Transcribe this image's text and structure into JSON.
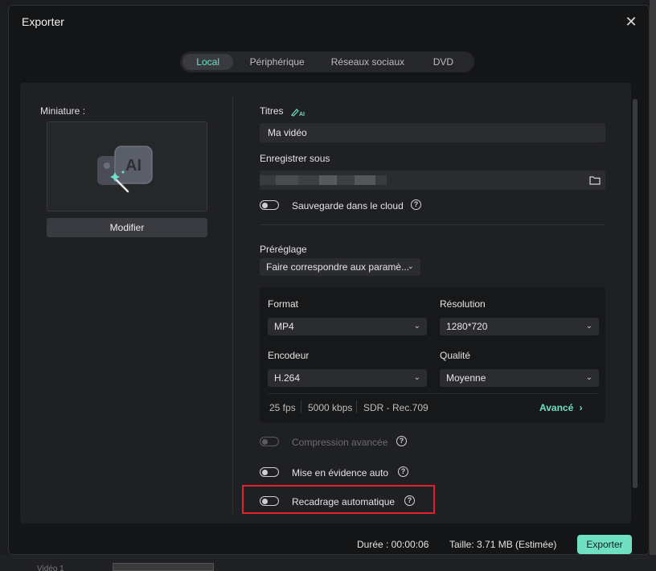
{
  "dialog": {
    "title": "Exporter",
    "close_icon": "close-icon"
  },
  "tabs": [
    {
      "label": "Local",
      "active": true
    },
    {
      "label": "Périphérique",
      "active": false
    },
    {
      "label": "Réseaux sociaux",
      "active": false
    },
    {
      "label": "DVD",
      "active": false
    }
  ],
  "thumbnail": {
    "label": "Miniature :",
    "modify_label": "Modifier",
    "icon": "ai-image-icon"
  },
  "title_field": {
    "label": "Titres",
    "value": "Ma vidéo",
    "ai_icon": "ai-pen-icon"
  },
  "save_as": {
    "label": "Enregistrer sous",
    "folder_icon": "folder-icon"
  },
  "cloud_backup": {
    "label": "Sauvegarde dans le cloud",
    "enabled": false
  },
  "preset": {
    "label": "Préréglage",
    "value": "Faire correspondre aux paramè..."
  },
  "settings": {
    "format_label": "Format",
    "format_value": "MP4",
    "resolution_label": "Résolution",
    "resolution_value": "1280*720",
    "encoder_label": "Encodeur",
    "encoder_value": "H.264",
    "quality_label": "Qualité",
    "quality_value": "Moyenne",
    "fps": "25 fps",
    "bitrate": "5000 kbps",
    "color_space": "SDR - Rec.709",
    "advanced_label": "Avancé"
  },
  "options": {
    "advanced_compression": {
      "label": "Compression avancée",
      "enabled": false,
      "disabled": true
    },
    "auto_highlight": {
      "label": "Mise en évidence auto",
      "enabled": false
    },
    "auto_reframe": {
      "label": "Recadrage automatique",
      "enabled": false
    }
  },
  "footer": {
    "duration": "Durée : 00:00:06",
    "size": "Taille: 3.71 MB (Estimée)",
    "export_label": "Exporter"
  },
  "background": {
    "timeline_label": "Vidéo 1"
  },
  "colors": {
    "accent": "#6fe0c4",
    "highlight": "#e0202a"
  }
}
